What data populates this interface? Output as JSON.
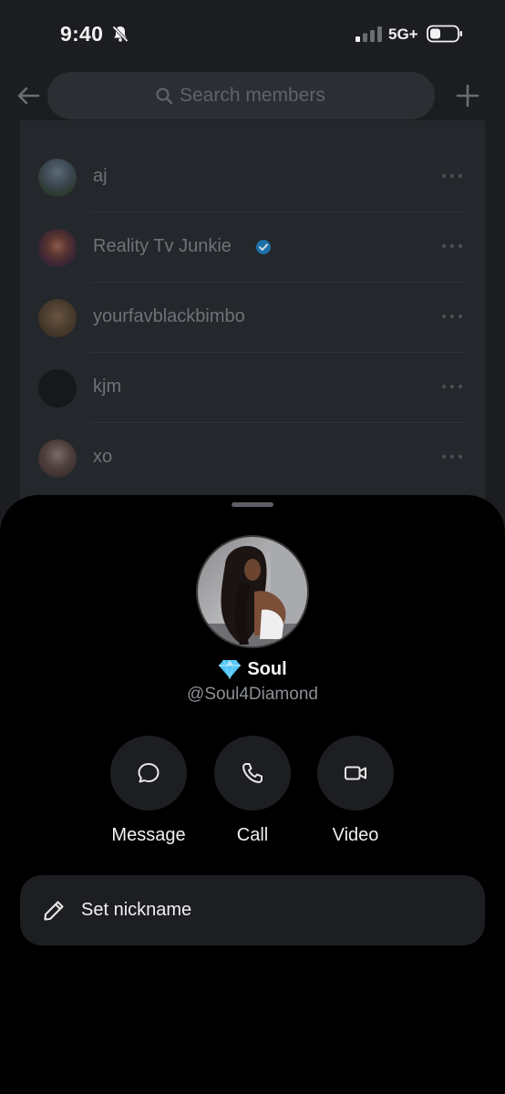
{
  "status_bar": {
    "time": "9:40",
    "network": "5G+"
  },
  "search": {
    "placeholder": "Search members"
  },
  "members": [
    {
      "name": "aj",
      "verified": false
    },
    {
      "name": "Reality Tv Junkie",
      "verified": true
    },
    {
      "name": "yourfavblackbimbo",
      "verified": false
    },
    {
      "name": "kjm",
      "verified": false
    },
    {
      "name": "xo",
      "verified": false
    }
  ],
  "profile": {
    "name": "Soul",
    "handle": "@Soul4Diamond"
  },
  "actions": {
    "message": "Message",
    "call": "Call",
    "video": "Video"
  },
  "nickname": {
    "label": "Set nickname"
  },
  "colors": {
    "sheet": "#000000",
    "button_bg": "#1c1e21",
    "verified": "#1d9bf0",
    "diamond": "#4fc3f7"
  }
}
